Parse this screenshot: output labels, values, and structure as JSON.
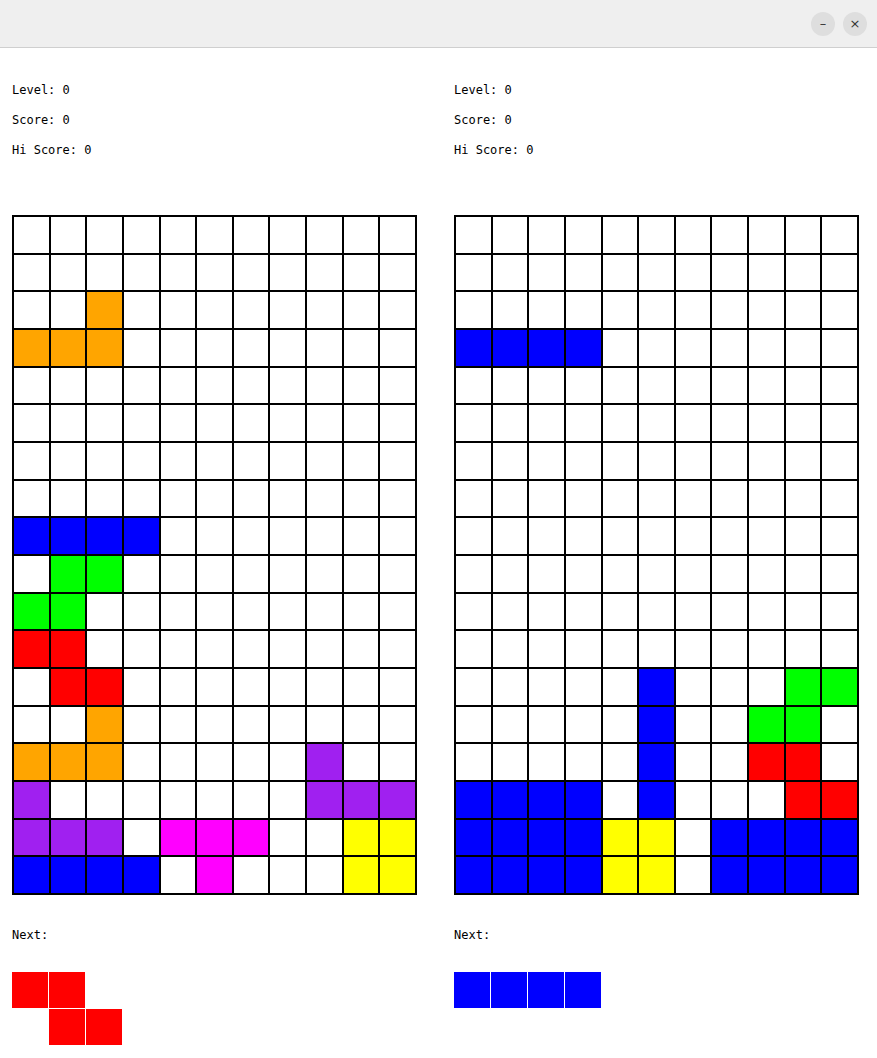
{
  "window": {
    "controls": [
      {
        "label": "–",
        "kind": "minimize"
      },
      {
        "label": "×",
        "kind": "close"
      }
    ]
  },
  "palette": {
    "O": "#ffa500",
    "B": "#0000ff",
    "G": "#00ff00",
    "R": "#ff0000",
    "P": "#a020f0",
    "M": "#ff00ff",
    "Y": "#ffff00"
  },
  "players": [
    {
      "stats": [
        "Level: 0",
        "Score: 0",
        "Hi Score: 0"
      ],
      "board": [
        "...........",
        "...........",
        "..O........",
        "OOO........",
        "...........",
        "...........",
        "...........",
        "...........",
        "BBBB.......",
        ".GG........",
        "GG.........",
        "RR.........",
        ".RR........",
        "..O........",
        "OOO.....P..",
        "P.......PPP",
        "PPP.MMM..YY",
        "BBBB.M...YY"
      ],
      "next_label": "Next:",
      "next": [
        "RR.",
        ".RR"
      ]
    },
    {
      "stats": [
        "Level: 0",
        "Score: 0",
        "Hi Score: 0"
      ],
      "board": [
        "...........",
        "...........",
        "...........",
        "BBBB.......",
        "...........",
        "...........",
        "...........",
        "...........",
        "...........",
        "...........",
        "...........",
        "...........",
        ".....B...GG",
        ".....B..GG.",
        ".....B..RR.",
        "BBBB.B...RR",
        "BBBBYY.BBBB",
        "BBBBYY.BBBB"
      ],
      "next_label": "Next:",
      "next": [
        "BBBB"
      ]
    }
  ]
}
